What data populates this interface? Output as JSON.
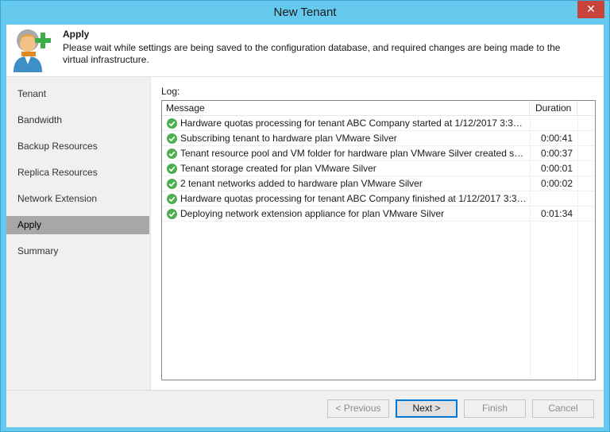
{
  "window": {
    "title": "New Tenant",
    "close_glyph": "✕"
  },
  "header": {
    "title": "Apply",
    "description": "Please wait while settings are being saved to the configuration database, and required changes are being made to the virtual infrastructure.",
    "icon": "tenant-add-icon"
  },
  "nav": {
    "items": [
      {
        "label": "Tenant"
      },
      {
        "label": "Bandwidth"
      },
      {
        "label": "Backup Resources"
      },
      {
        "label": "Replica Resources"
      },
      {
        "label": "Network Extension"
      },
      {
        "label": "Apply",
        "active": true
      },
      {
        "label": "Summary"
      }
    ]
  },
  "log": {
    "label": "Log:",
    "columns": {
      "message": "Message",
      "duration": "Duration"
    },
    "rows": [
      {
        "status": "success",
        "message": "Hardware quotas processing for tenant ABC Company started at 1/12/2017 3:33:5...",
        "duration": ""
      },
      {
        "status": "success",
        "message": "Subscribing tenant to hardware plan VMware Silver",
        "duration": "0:00:41"
      },
      {
        "status": "success",
        "message": "Tenant resource pool and VM folder for hardware plan VMware Silver created suc...",
        "duration": "0:00:37"
      },
      {
        "status": "success",
        "message": "Tenant storage created for plan VMware Silver",
        "duration": "0:00:01"
      },
      {
        "status": "success",
        "message": "2 tenant networks added to hardware plan VMware Silver",
        "duration": "0:00:02"
      },
      {
        "status": "success",
        "message": "Hardware quotas processing for tenant ABC Company finished at 1/12/2017 3:34:...",
        "duration": ""
      },
      {
        "status": "success",
        "message": "Deploying network extension appliance for plan VMware Silver",
        "duration": "0:01:34"
      }
    ]
  },
  "buttons": {
    "previous": "< Previous",
    "next": "Next >",
    "finish": "Finish",
    "cancel": "Cancel"
  },
  "colors": {
    "titlebar": "#66c9ee",
    "success": "#4cae4c",
    "close": "#c8443a",
    "nav_active": "#a7a7a7"
  }
}
